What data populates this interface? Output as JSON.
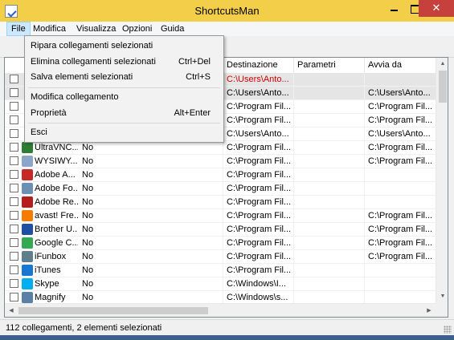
{
  "window": {
    "title": "ShortcutsMan",
    "close_glyph": "✕"
  },
  "colors": {
    "titlebar": "#f3cf49",
    "close_button": "#c7413c",
    "broken_link_text": "#d40000",
    "menu_active": "#cce8ff"
  },
  "menubar": [
    {
      "label": "File",
      "active": true
    },
    {
      "label": "Modifica"
    },
    {
      "label": "Visualizza"
    },
    {
      "label": "Opzioni"
    },
    {
      "label": "Guida"
    }
  ],
  "file_menu": {
    "items": [
      {
        "label": "Ripara collegamenti selezionati",
        "shortcut": ""
      },
      {
        "label": "Elimina collegamenti selezionati",
        "shortcut": "Ctrl+Del"
      },
      {
        "label": "Salva elementi selezionati",
        "shortcut": "Ctrl+S"
      },
      {
        "label": "Modifica collegamento",
        "shortcut": ""
      },
      {
        "label": "Proprietà",
        "shortcut": "Alt+Enter"
      },
      {
        "label": "Esci",
        "shortcut": ""
      }
    ]
  },
  "table": {
    "columns": [
      "Destinazione",
      "Parametri",
      "Avvia da"
    ],
    "rows": [
      {
        "name": "",
        "broken": "",
        "destination": "C:\\Users\\Anto...",
        "params": "",
        "start_in": "",
        "selected": true,
        "red": true,
        "icon": "blank-icon"
      },
      {
        "name": "",
        "broken": "",
        "destination": "C:\\Users\\Anto...",
        "params": "",
        "start_in": "C:\\Users\\Anto...",
        "selected": true,
        "red": false,
        "icon": "blank-icon"
      },
      {
        "name": "",
        "broken": "",
        "destination": "C:\\Program Fil...",
        "params": "",
        "start_in": "C:\\Program Fil...",
        "selected": false,
        "red": false,
        "icon": "blank-icon"
      },
      {
        "name": "",
        "broken": "",
        "destination": "C:\\Program Fil...",
        "params": "",
        "start_in": "C:\\Program Fil...",
        "selected": false,
        "red": false,
        "icon": "blank-icon"
      },
      {
        "name": "",
        "broken": "",
        "destination": "C:\\Users\\Anto...",
        "params": "",
        "start_in": "C:\\Users\\Anto...",
        "selected": false,
        "red": false,
        "icon": "blank-icon"
      },
      {
        "name": "UltraVNC...",
        "broken": "No",
        "destination": "C:\\Program Fil...",
        "params": "",
        "start_in": "C:\\Program Fil...",
        "icon": "ultravnc-icon",
        "icon_color": "#2e7d32"
      },
      {
        "name": "WYSIWY...",
        "broken": "No",
        "destination": "C:\\Program Fil...",
        "params": "",
        "start_in": "C:\\Program Fil...",
        "icon": "wysiwyg-icon",
        "icon_color": "#8aa6c8"
      },
      {
        "name": "Adobe A...",
        "broken": "No",
        "destination": "C:\\Program Fil...",
        "params": "",
        "start_in": "",
        "icon": "adobe-acrobat-icon",
        "icon_color": "#c62828"
      },
      {
        "name": "Adobe Fo...",
        "broken": "No",
        "destination": "C:\\Program Fil...",
        "params": "",
        "start_in": "",
        "icon": "adobe-forms-icon",
        "icon_color": "#6d8fb3"
      },
      {
        "name": "Adobe Re...",
        "broken": "No",
        "destination": "C:\\Program Fil...",
        "params": "",
        "start_in": "",
        "icon": "adobe-reader-icon",
        "icon_color": "#b71c1c"
      },
      {
        "name": "avast! Fre...",
        "broken": "No",
        "destination": "C:\\Program Fil...",
        "params": "",
        "start_in": "C:\\Program Fil...",
        "icon": "avast-icon",
        "icon_color": "#f57c00"
      },
      {
        "name": "Brother U...",
        "broken": "No",
        "destination": "C:\\Program Fil...",
        "params": "",
        "start_in": "C:\\Program Fil...",
        "icon": "brother-icon",
        "icon_color": "#1e4fa3"
      },
      {
        "name": "Google C...",
        "broken": "No",
        "destination": "C:\\Program Fil...",
        "params": "",
        "start_in": "C:\\Program Fil...",
        "icon": "google-chrome-icon",
        "icon_color": "#34a853"
      },
      {
        "name": "iFunbox",
        "broken": "No",
        "destination": "C:\\Program Fil...",
        "params": "",
        "start_in": "C:\\Program Fil...",
        "icon": "ifunbox-icon",
        "icon_color": "#607d8b"
      },
      {
        "name": "iTunes",
        "broken": "No",
        "destination": "C:\\Program Fil...",
        "params": "",
        "start_in": "",
        "icon": "itunes-icon",
        "icon_color": "#1976d2"
      },
      {
        "name": "Skype",
        "broken": "No",
        "destination": "C:\\Windows\\I...",
        "params": "",
        "start_in": "",
        "icon": "skype-icon",
        "icon_color": "#00aff0"
      },
      {
        "name": "Magnify",
        "broken": "No",
        "destination": "C:\\Windows\\s...",
        "params": "",
        "start_in": "",
        "icon": "magnify-icon",
        "icon_color": "#5c7fa6"
      }
    ]
  },
  "status": {
    "text": "112 collegamenti, 2 elementi selezionati"
  }
}
